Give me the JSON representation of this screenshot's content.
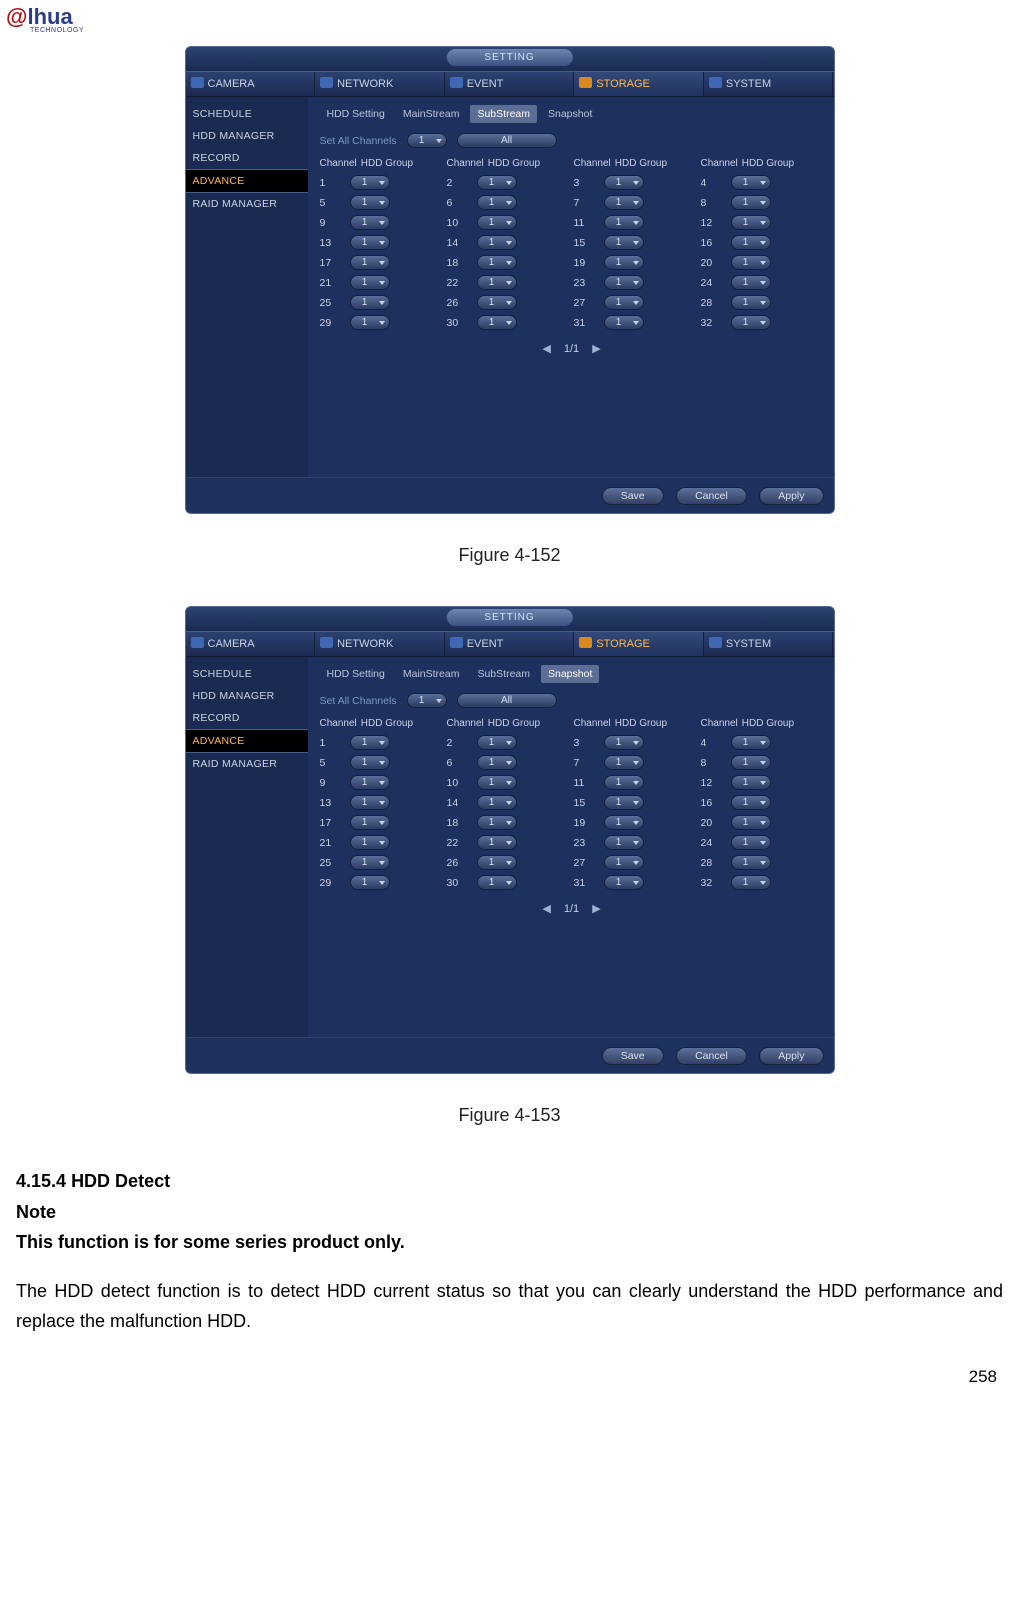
{
  "logo": {
    "part1": "a",
    "part2": "lhua",
    "sub": "TECHNOLOGY"
  },
  "window_title": "SETTING",
  "top_tabs": [
    "CAMERA",
    "NETWORK",
    "EVENT",
    "STORAGE",
    "SYSTEM"
  ],
  "active_top_tab_index": 3,
  "sidebar": [
    "SCHEDULE",
    "HDD MANAGER",
    "RECORD",
    "ADVANCE",
    "RAID MANAGER"
  ],
  "active_sidebar_index": 3,
  "subtabs": [
    "HDD Setting",
    "MainStream",
    "SubStream",
    "Snapshot"
  ],
  "fig1_active_subtab_index": 2,
  "fig2_active_subtab_index": 3,
  "set_all_label": "Set All Channels",
  "set_all_value": "1",
  "all_btn": "All",
  "col_channel": "Channel",
  "col_group": "HDD Group",
  "channels": [
    "1",
    "2",
    "3",
    "4",
    "5",
    "6",
    "7",
    "8",
    "9",
    "10",
    "11",
    "12",
    "13",
    "14",
    "15",
    "16",
    "17",
    "18",
    "19",
    "20",
    "21",
    "22",
    "23",
    "24",
    "25",
    "26",
    "27",
    "28",
    "29",
    "30",
    "31",
    "32"
  ],
  "group_value": "1",
  "pager": "1/1",
  "btn_save": "Save",
  "btn_cancel": "Cancel",
  "btn_apply": "Apply",
  "caption1": "Figure 4-152",
  "caption2": "Figure 4-153",
  "sec_num": "4.15.4",
  "sec_title": "HDD Detect",
  "note": "Note",
  "note_body": "This function is for some series product only.",
  "body": "The HDD detect function is to detect HDD current status so that you can clearly understand the HDD performance and replace the malfunction HDD.",
  "page_num": "258"
}
